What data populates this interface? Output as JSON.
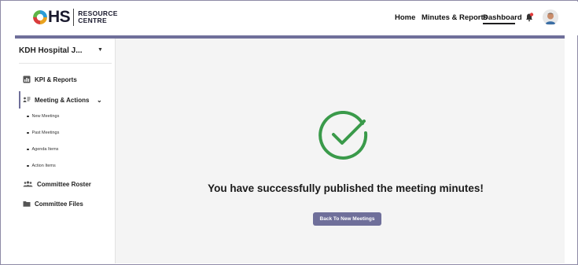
{
  "brand": {
    "logo_letters": "HS",
    "logo_sub_line1": "RESOURCE",
    "logo_sub_line2": "CENTRE"
  },
  "nav": {
    "home": "Home",
    "minutes_reports": "Minutes & Reports",
    "dashboard": "Dashboard",
    "active": "Dashboard"
  },
  "colors": {
    "accent": "#6f6f9a",
    "success": "#3a9a4a",
    "main_bg": "#f4f4f4"
  },
  "sidebar": {
    "org_name": "KDH Hospital J...",
    "items": [
      {
        "label": "KPI & Reports",
        "icon": "bar-chart-icon"
      },
      {
        "label": "Meeting & Actions",
        "icon": "meeting-icon",
        "expanded": true
      },
      {
        "label": "Committee Roster",
        "icon": "people-icon"
      },
      {
        "label": "Committee Files",
        "icon": "folder-icon"
      }
    ],
    "sub_items": [
      "New Meetings",
      "Past Meetings",
      "Agenda Items",
      "Action Items"
    ]
  },
  "main": {
    "message": "You have successfully published the meeting minutes!",
    "button_label": "Back To New Meetings"
  }
}
